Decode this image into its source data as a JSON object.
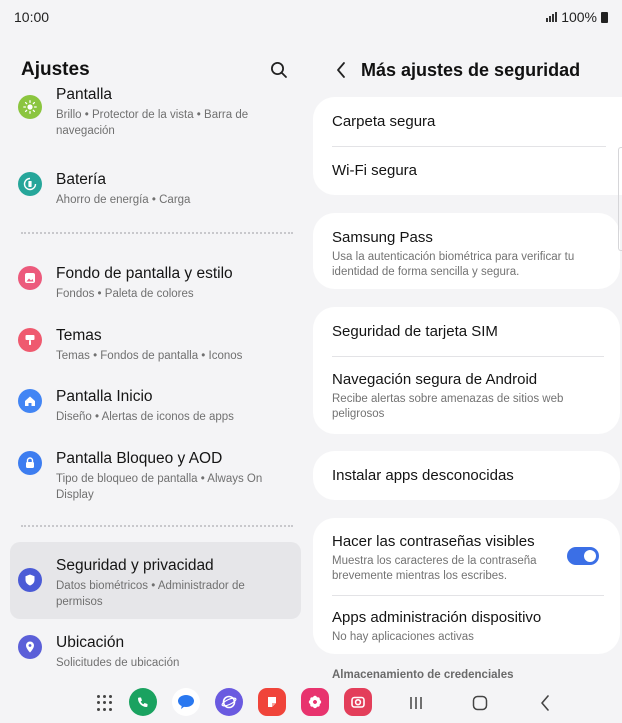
{
  "status": {
    "time": "10:00",
    "battery_text": "100%"
  },
  "left": {
    "title": "Ajustes",
    "items": [
      {
        "title": "Pantalla",
        "sub": "Brillo • Protector de la vista • Barra de navegación",
        "icon": "sun-icon",
        "color": "#8bc53f"
      },
      {
        "title": "Batería",
        "sub": "Ahorro de energía • Carga",
        "icon": "battery-refresh-icon",
        "color": "#26a69a"
      },
      {
        "title": "Fondo de pantalla y estilo",
        "sub": "Fondos • Paleta de colores",
        "icon": "wallpaper-icon",
        "color": "#ec5a7c"
      },
      {
        "title": "Temas",
        "sub": "Temas • Fondos de pantalla • Iconos",
        "icon": "brush-icon",
        "color": "#ef5a6f"
      },
      {
        "title": "Pantalla Inicio",
        "sub": "Diseño • Alertas de iconos de apps",
        "icon": "home-icon",
        "color": "#4285f4"
      },
      {
        "title": "Pantalla Bloqueo y AOD",
        "sub": "Tipo de bloqueo de pantalla • Always On Display",
        "icon": "lock-icon",
        "color": "#3d7df0"
      },
      {
        "title": "Seguridad y privacidad",
        "sub": "Datos biométricos • Administrador de permisos",
        "icon": "shield-icon",
        "color": "#4b5bd6"
      },
      {
        "title": "Ubicación",
        "sub": "Solicitudes de ubicación",
        "icon": "location-pin-icon",
        "color": "#5b5fd8"
      }
    ]
  },
  "right": {
    "title": "Más ajustes de seguridad",
    "rows": {
      "carpeta": "Carpeta segura",
      "wifi": "Wi-Fi segura",
      "pass_title": "Samsung Pass",
      "pass_sub": "Usa la autenticación biométrica para verificar tu identidad de forma sencilla y segura.",
      "sim": "Seguridad de tarjeta SIM",
      "nav_title": "Navegación segura de Android",
      "nav_sub": "Recibe alertas sobre amenazas de sitios web peligrosos",
      "install": "Instalar apps desconocidas",
      "pw_title": "Hacer las contraseñas visibles",
      "pw_sub": "Muestra los caracteres de la contraseña brevemente mientras los escribes.",
      "pw_toggle": "on",
      "admin_title": "Apps administración dispositivo",
      "admin_sub": "No hay aplicaciones activas"
    },
    "caption": "Almacenamiento de credenciales"
  },
  "dock": [
    {
      "name": "phone-app",
      "color": "#1aa260"
    },
    {
      "name": "messages-app",
      "color": "#2a78f0"
    },
    {
      "name": "internet-app",
      "color": "#6a5ae0"
    },
    {
      "name": "notes-app",
      "color": "#f0443a"
    },
    {
      "name": "gallery-app",
      "color": "#e8336e"
    },
    {
      "name": "camera-app",
      "color": "#e33e5a"
    }
  ]
}
